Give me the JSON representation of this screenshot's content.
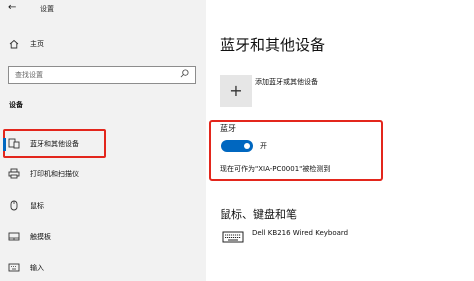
{
  "window": {
    "back_glyph": "←",
    "title": "设置"
  },
  "sidebar": {
    "home_label": "主页",
    "search_placeholder": "查找设置",
    "section_label": "设备",
    "items": [
      {
        "label": "蓝牙和其他设备",
        "icon": "bluetooth-devices-icon",
        "active": true
      },
      {
        "label": "打印机和扫描仪",
        "icon": "printer-icon"
      },
      {
        "label": "鼠标",
        "icon": "mouse-icon"
      },
      {
        "label": "触摸板",
        "icon": "touchpad-icon"
      },
      {
        "label": "输入",
        "icon": "keyboard-icon"
      }
    ]
  },
  "main": {
    "title": "蓝牙和其他设备",
    "add_device_label": "添加蓝牙或其他设备",
    "bluetooth": {
      "heading": "蓝牙",
      "toggle_state": "开",
      "discover_text": "现在可作为\"XIA-PC0001\"被检测到"
    },
    "mouse_keyboard_section": "鼠标、键盘和笔",
    "devices": [
      {
        "name": "Dell KB216 Wired Keyboard",
        "icon": "keyboard-icon"
      }
    ]
  },
  "colors": {
    "accent": "#0067c0",
    "highlight_box": "#e3261c",
    "sidebar_bg": "#f2f2f2"
  }
}
